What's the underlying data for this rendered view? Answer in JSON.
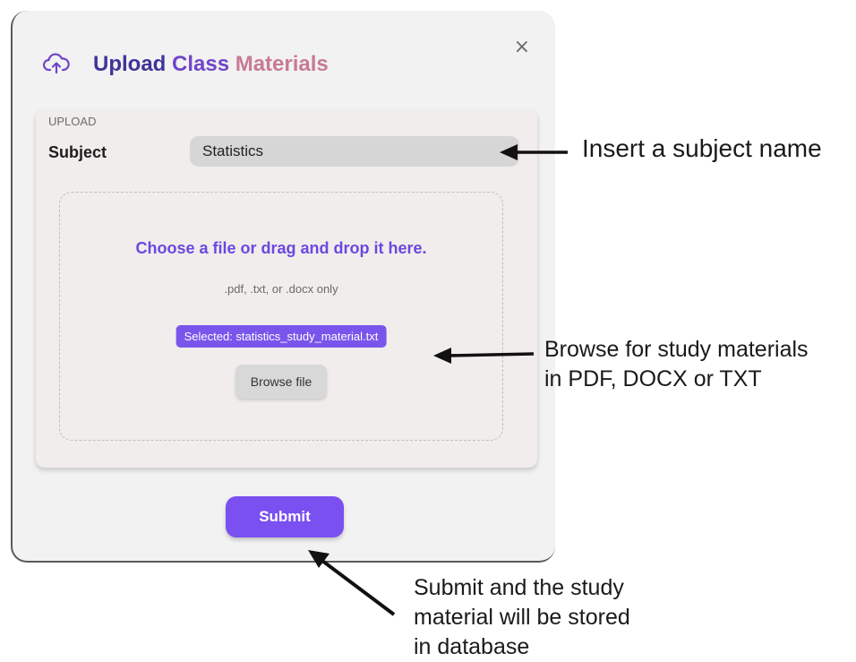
{
  "modal": {
    "close_label": "×",
    "title_part1": "Upload",
    "title_part2": "Class",
    "title_part3": "Materials",
    "title_colors": [
      "#3e3399",
      "#6f45c8",
      "#c77a95"
    ],
    "icon": "cloud-upload-icon"
  },
  "upload_card": {
    "section_label": "UPLOAD",
    "subject_label": "Subject",
    "subject_value": "Statistics",
    "dropzone_title": "Choose a file or drag and drop it here.",
    "dropzone_hint": ".pdf, .txt, or .docx only",
    "selected_file": "Selected: statistics_study_material.txt",
    "browse_label": "Browse file"
  },
  "submit_label": "Submit",
  "annotations": {
    "subject": "Insert a subject name",
    "browse_line1": "Browse for study materials",
    "browse_line2": "in PDF, DOCX or TXT",
    "submit_line1": "Submit and the study",
    "submit_line2": "material will be stored",
    "submit_line3": "in database"
  },
  "colors": {
    "accent": "#7a50f0",
    "badge": "#7a55ec",
    "dropzone_title": "#6d47e0"
  }
}
